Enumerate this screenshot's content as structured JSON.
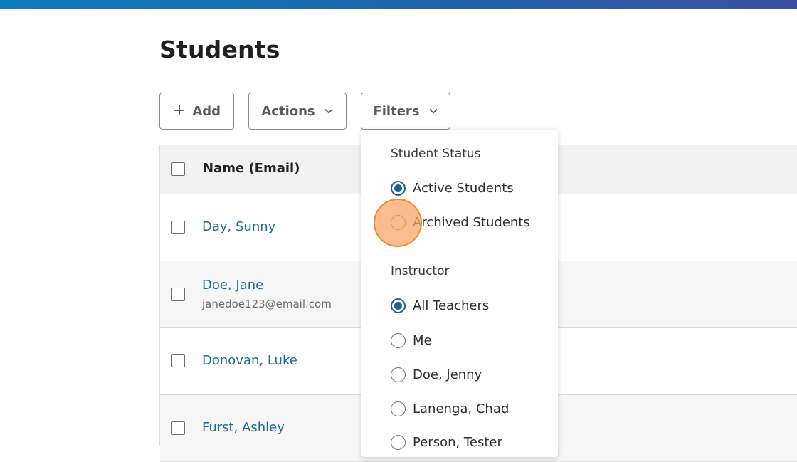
{
  "page": {
    "title": "Students"
  },
  "toolbar": {
    "add_label": "Add",
    "actions_label": "Actions",
    "filters_label": "Filters"
  },
  "table": {
    "header": {
      "name_col": "Name (Email)"
    },
    "rows": [
      {
        "name": "Day, Sunny",
        "email": ""
      },
      {
        "name": "Doe, Jane",
        "email": "janedoe123@email.com"
      },
      {
        "name": "Donovan, Luke",
        "email": ""
      },
      {
        "name": "Furst, Ashley",
        "email": ""
      }
    ]
  },
  "filters_menu": {
    "student_status": {
      "heading": "Student Status",
      "options": [
        {
          "label": "Active Students",
          "selected": true
        },
        {
          "label": "Archived Students",
          "selected": false
        }
      ]
    },
    "instructor": {
      "heading": "Instructor",
      "options": [
        {
          "label": "All Teachers",
          "selected": true
        },
        {
          "label": "Me",
          "selected": false
        },
        {
          "label": "Doe, Jenny",
          "selected": false
        },
        {
          "label": "Lanenga, Chad",
          "selected": false
        },
        {
          "label": "Person, Tester",
          "selected": false
        }
      ]
    }
  },
  "colors": {
    "accent": "#1d5f8a",
    "link": "#1a6b96",
    "cursor_highlight": "#f6a66c",
    "topbar_start": "#0f7bbf",
    "topbar_end": "#3a4fa3"
  }
}
